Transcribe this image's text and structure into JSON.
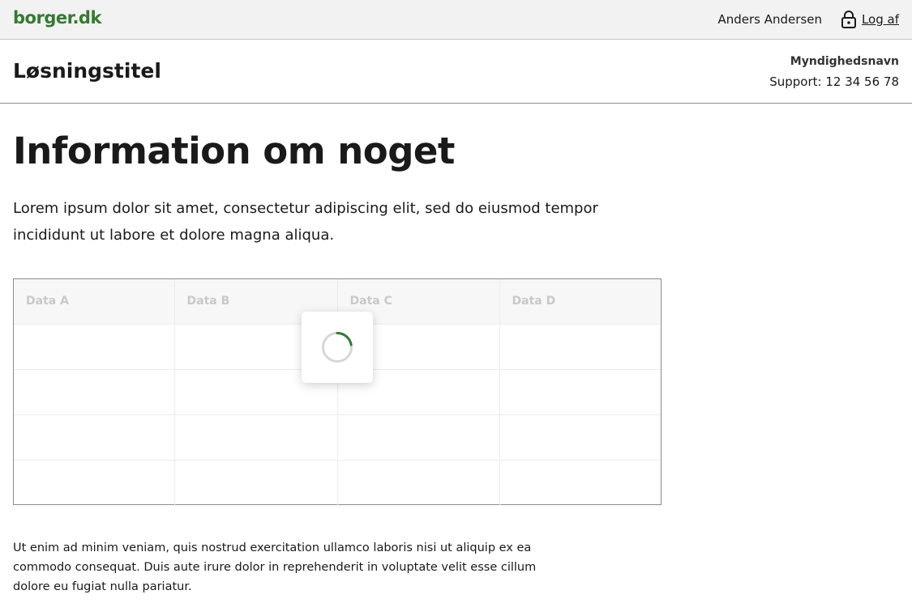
{
  "topbar": {
    "logo": "borger.dk",
    "user_name": "Anders Andersen",
    "logout_label": "Log af",
    "logout_icon": "lock-icon"
  },
  "solution": {
    "title": "Løsningstitel",
    "authority": "Myndighedsnavn",
    "support": "Support: 12 34 56 78"
  },
  "main": {
    "title": "Information om noget",
    "lead": "Lorem ipsum dolor sit amet, consectetur adipiscing elit, sed do eiusmod tempor incididunt ut labore et dolore magna aliqua.",
    "table": {
      "headers": [
        "Data A",
        "Data B",
        "Data C",
        "Data D"
      ],
      "loading": true
    },
    "body": "Ut enim ad minim veniam, quis nostrud exercitation ullamco laboris nisi ut aliquip ex ea commodo consequat. Duis aute irure dolor in reprehenderit in voluptate velit esse cillum dolore eu fugiat nulla pariatur."
  },
  "colors": {
    "brand": "#357a32",
    "text": "#1a1a1a",
    "topbar_bg": "#f2f2f2"
  }
}
